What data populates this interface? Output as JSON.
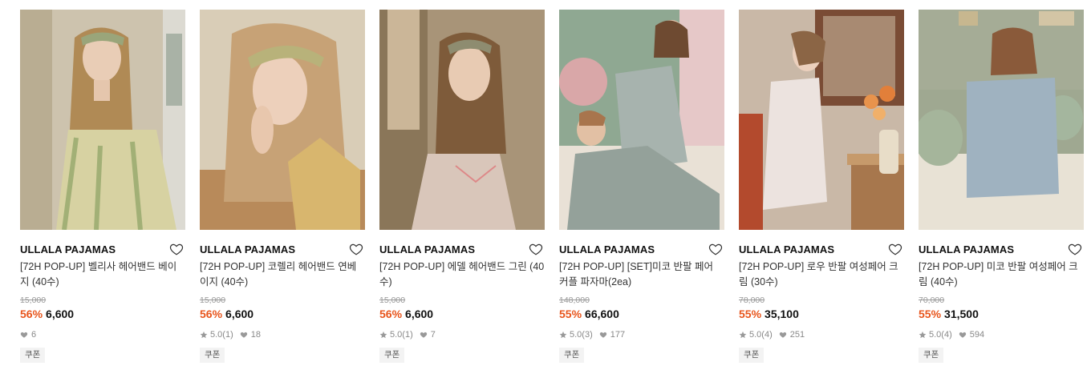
{
  "colors": {
    "discount": "#e8551c",
    "price": "#111111",
    "meta": "#888888"
  },
  "products": [
    {
      "brand": "ULLALA PAJAMAS",
      "name": "[72H POP-UP] 벨리사 헤어밴드 베이지 (40수)",
      "original_price": "15,000",
      "discount": "56%",
      "price": "6,600",
      "rating": "",
      "reviews": "",
      "likes": "6",
      "coupon": "쿠폰",
      "wishlist_icon": "heart-outline-icon",
      "image": "model-in-floral-sleeveless-dress"
    },
    {
      "brand": "ULLALA PAJAMAS",
      "name": "[72H POP-UP] 코렐리 헤어밴드 연베이지 (40수)",
      "original_price": "15,000",
      "discount": "56%",
      "price": "6,600",
      "rating": "5.0",
      "reviews": "(1)",
      "likes": "18",
      "coupon": "쿠폰",
      "wishlist_icon": "heart-outline-icon",
      "image": "model-with-headband-closeup"
    },
    {
      "brand": "ULLALA PAJAMAS",
      "name": "[72H POP-UP] 에델 헤어밴드 그린 (40수)",
      "original_price": "15,000",
      "discount": "56%",
      "price": "6,600",
      "rating": "5.0",
      "reviews": "(1)",
      "likes": "7",
      "coupon": "쿠폰",
      "wishlist_icon": "heart-outline-icon",
      "image": "model-in-floral-slip"
    },
    {
      "brand": "ULLALA PAJAMAS",
      "name": "[72H POP-UP] [SET]미코 반팔 페어 커플 파자마(2ea)",
      "original_price": "148,000",
      "discount": "55%",
      "price": "66,600",
      "rating": "5.0",
      "reviews": "(3)",
      "likes": "177",
      "coupon": "쿠폰",
      "wishlist_icon": "heart-outline-icon",
      "image": "couple-in-striped-pajamas"
    },
    {
      "brand": "ULLALA PAJAMAS",
      "name": "[72H POP-UP] 로우 반팔 여성페어 크림 (30수)",
      "original_price": "78,000",
      "discount": "55%",
      "price": "35,100",
      "rating": "5.0",
      "reviews": "(4)",
      "likes": "251",
      "coupon": "쿠폰",
      "wishlist_icon": "heart-outline-icon",
      "image": "model-seated-at-table-with-flowers"
    },
    {
      "brand": "ULLALA PAJAMAS",
      "name": "[72H POP-UP] 미코 반팔 여성페어 크림 (40수)",
      "original_price": "70,000",
      "discount": "55%",
      "price": "31,500",
      "rating": "5.0",
      "reviews": "(4)",
      "likes": "594",
      "coupon": "쿠폰",
      "wishlist_icon": "heart-outline-icon",
      "image": "model-seated-on-bed-striped-pajamas"
    }
  ]
}
